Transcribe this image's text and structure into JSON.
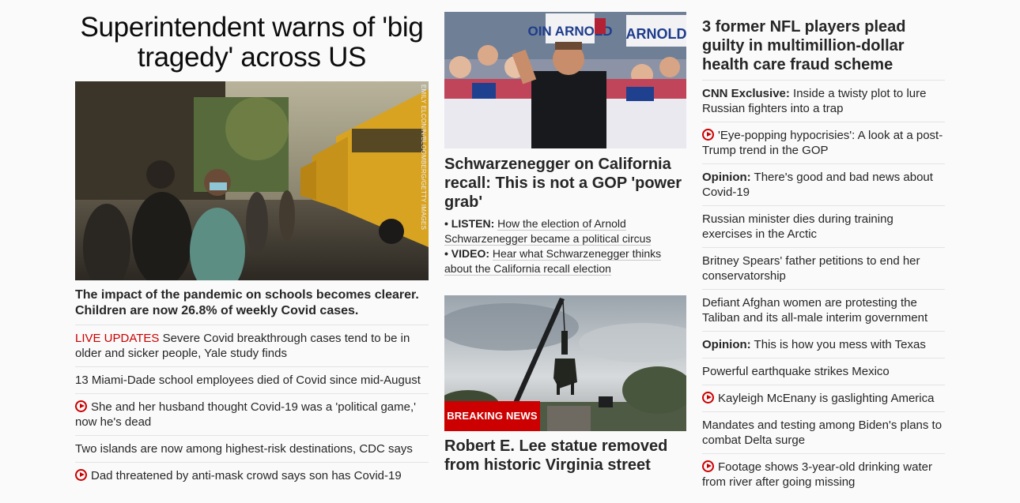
{
  "left": {
    "title": "Superintendent warns of 'big tragedy' across US",
    "image_credit": "EMILY ELCONIN/BLOOMBERG/GETTY IMAGES",
    "subhead": "The impact of the pandemic on schools becomes clearer. Children are now 26.8% of weekly Covid cases.",
    "items": [
      {
        "tag": "LIVE UPDATES",
        "text": " Severe Covid breakthrough cases tend to be in older and sicker people, Yale study finds",
        "video": false
      },
      {
        "tag": "",
        "text": "13 Miami-Dade school employees died of Covid since mid-August",
        "video": false
      },
      {
        "tag": "",
        "text": "She and her husband thought Covid-19 was a 'political game,' now he's dead",
        "video": true
      },
      {
        "tag": "",
        "text": "Two islands are now among highest-risk destinations, CDC says",
        "video": false
      },
      {
        "tag": "",
        "text": "Dad threatened by anti-mask crowd says son has Covid-19",
        "video": true
      }
    ]
  },
  "middle": {
    "story1": {
      "title": "Schwarzenegger on California recall: This is not a GOP 'power grab'",
      "sign1": "OIN ARNOLD",
      "sign2": "ARNOLD",
      "links": [
        {
          "bullet": "•",
          "label": "LISTEN:",
          "text": "How the election of Arnold Schwarzenegger became a political circus"
        },
        {
          "bullet": "•",
          "label": "VIDEO:",
          "text": "Hear what Schwarzenegger thinks about the California recall election"
        }
      ]
    },
    "story2": {
      "badge": "BREAKING NEWS",
      "title": "Robert E. Lee statue removed from historic Virginia street"
    }
  },
  "right": {
    "title": "3 former NFL players plead guilty in multimillion-dollar health care fraud scheme",
    "items": [
      {
        "label": "CNN Exclusive:",
        "text": " Inside a twisty plot to lure Russian fighters into a trap",
        "video": false
      },
      {
        "label": "",
        "text": "'Eye-popping hypocrisies': A look at a post-Trump trend in the GOP",
        "video": true
      },
      {
        "label": "Opinion:",
        "text": " There's good and bad news about Covid-19",
        "video": false
      },
      {
        "label": "",
        "text": "Russian minister dies during training exercises in the Arctic",
        "video": false
      },
      {
        "label": "",
        "text": "Britney Spears' father petitions to end her conservatorship",
        "video": false
      },
      {
        "label": "",
        "text": "Defiant Afghan women are protesting the Taliban and its all-male interim government",
        "video": false
      },
      {
        "label": "Opinion:",
        "text": " This is how you mess with Texas",
        "video": false
      },
      {
        "label": "",
        "text": "Powerful earthquake strikes Mexico",
        "video": false
      },
      {
        "label": "",
        "text": "Kayleigh McEnany is gaslighting America",
        "video": true
      },
      {
        "label": "",
        "text": "Mandates and testing among Biden's plans to combat Delta surge",
        "video": false
      },
      {
        "label": "",
        "text": "Footage shows 3-year-old drinking water from river after going missing",
        "video": true
      }
    ]
  },
  "colors": {
    "accent": "#cc0000",
    "text": "#262626",
    "divider": "#e3e3e3"
  }
}
